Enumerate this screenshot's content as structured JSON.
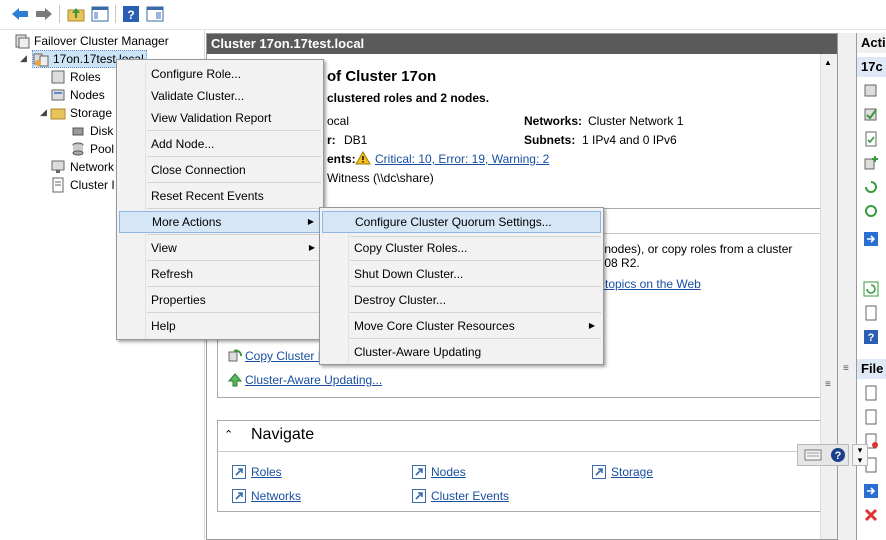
{
  "toolbar": {
    "back": "back-arrow-icon",
    "forward": "forward-arrow-icon",
    "up": "up-folder-icon",
    "show_hide_tree": "console-tree-icon",
    "help": "help-icon",
    "show_hide_action": "action-pane-icon"
  },
  "tree": {
    "root": "Failover Cluster Manager",
    "cluster": "17on.17test.local",
    "roles": "Roles",
    "nodes": "Nodes",
    "storage": "Storage",
    "disks": "Disk",
    "pools": "Pool",
    "networks": "Network",
    "cluster_events": "Cluster I"
  },
  "center": {
    "header": "Cluster 17on.17test.local",
    "summary_title": "of Cluster 17on",
    "summary_sub": "clustered roles and 2 nodes.",
    "domain_value": "ocal",
    "server_label": "r:",
    "server_value": "DB1",
    "events_label": "ents:",
    "events_link": "Critical: 10, Error: 19, Warning: 2",
    "witness": "Witness (\\\\dc\\share)",
    "networks_label": "Networks:",
    "networks_value": "Cluster Network 1",
    "subnets_label": "Subnets:",
    "subnets_value": "1 IPv4 and 0 IPv6",
    "configure_text1": "s (nodes), or copy roles from a cluster",
    "configure_text2": "2008 R2.",
    "topics_link": "er topics on the Web",
    "copy_roles_link": "Copy Cluster Ro",
    "cau_link": "Cluster-Aware Updating...",
    "navigate_title": "Navigate",
    "nav": {
      "roles": "Roles",
      "nodes": "Nodes",
      "storage": "Storage",
      "networks": "Networks",
      "events": "Cluster Events"
    }
  },
  "actions": {
    "header1": "Acti",
    "header2": "17c",
    "header3": "File"
  },
  "context_menu": {
    "items": [
      "Configure Role...",
      "Validate Cluster...",
      "View Validation Report",
      "Add Node...",
      "Close Connection",
      "Reset Recent Events",
      "More Actions",
      "View",
      "Refresh",
      "Properties",
      "Help"
    ]
  },
  "submenu": {
    "items": [
      "Configure Cluster Quorum Settings...",
      "Copy Cluster Roles...",
      "Shut Down Cluster...",
      "Destroy Cluster...",
      "Move Core Cluster Resources",
      "Cluster-Aware Updating"
    ]
  },
  "colors": {
    "header_bg": "#5a5a5a",
    "link": "#1a4fa0",
    "menu_highlight": "#d5e6f7",
    "selection": "#cce4f7"
  }
}
